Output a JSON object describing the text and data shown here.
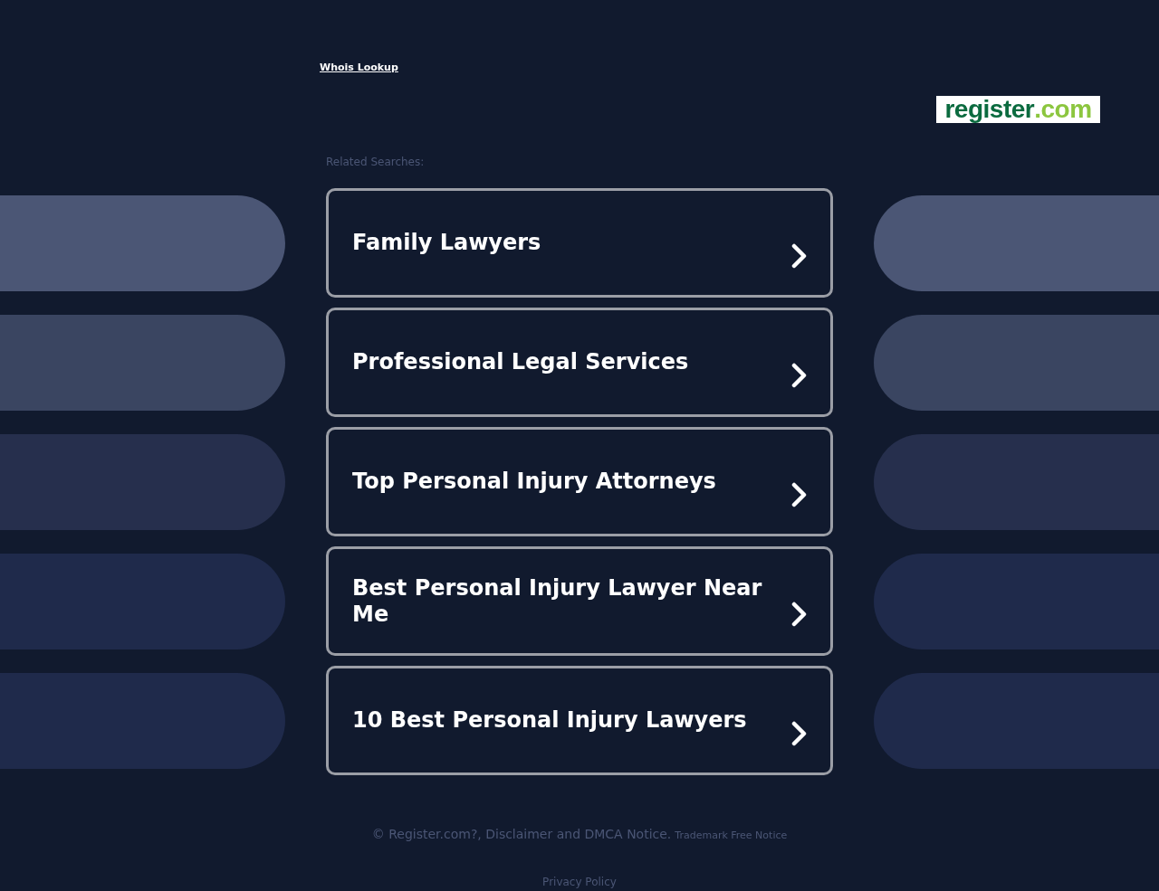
{
  "header": {
    "whois_link": "Whois Lookup",
    "logo": {
      "name": "register",
      "suffix": ".com"
    }
  },
  "related_searches": {
    "heading": "Related Searches:",
    "items": [
      "Family Lawyers",
      "Professional Legal Services",
      "Top Personal Injury Attorneys",
      "Best Personal Injury Lawyer Near Me",
      "10 Best Personal Injury Lawyers"
    ]
  },
  "footer": {
    "notice": "© Register.com?, Disclaimer and DMCA Notice.",
    "trademark_link": "Trademark Free Notice",
    "privacy_link": "Privacy Policy"
  }
}
